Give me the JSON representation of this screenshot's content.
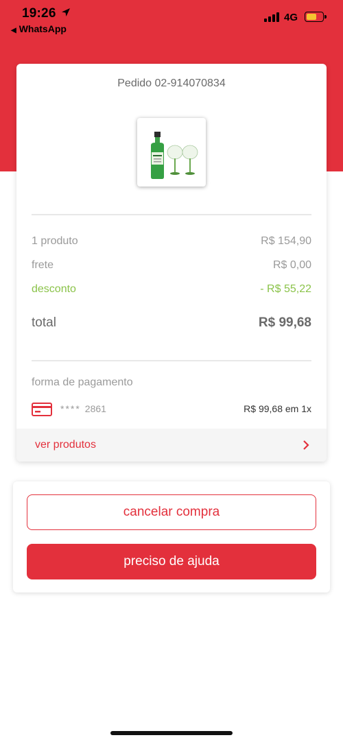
{
  "status_bar": {
    "time": "19:26",
    "back_app": "WhatsApp",
    "network": "4G",
    "battery_level": 0.65,
    "battery_color": "#f5c431"
  },
  "colors": {
    "accent": "#e3303c",
    "discount": "#8bc34a"
  },
  "order": {
    "id_label": "Pedido 02-914070834",
    "product_image": "gin-bottle-with-glasses",
    "summary": {
      "products_label": "1 produto",
      "products_value": "R$ 154,90",
      "shipping_label": "frete",
      "shipping_value": "R$ 0,00",
      "discount_label": "desconto",
      "discount_value": "- R$ 55,22",
      "total_label": "total",
      "total_value": "R$ 99,68"
    },
    "payment": {
      "title": "forma de pagamento",
      "card_icon": "credit-card-icon",
      "card_mask": "****",
      "card_last4": "2861",
      "amount": "R$ 99,68 em 1x"
    },
    "see_products_label": "ver produtos"
  },
  "actions": {
    "cancel_label": "cancelar compra",
    "help_label": "preciso de ajuda"
  }
}
